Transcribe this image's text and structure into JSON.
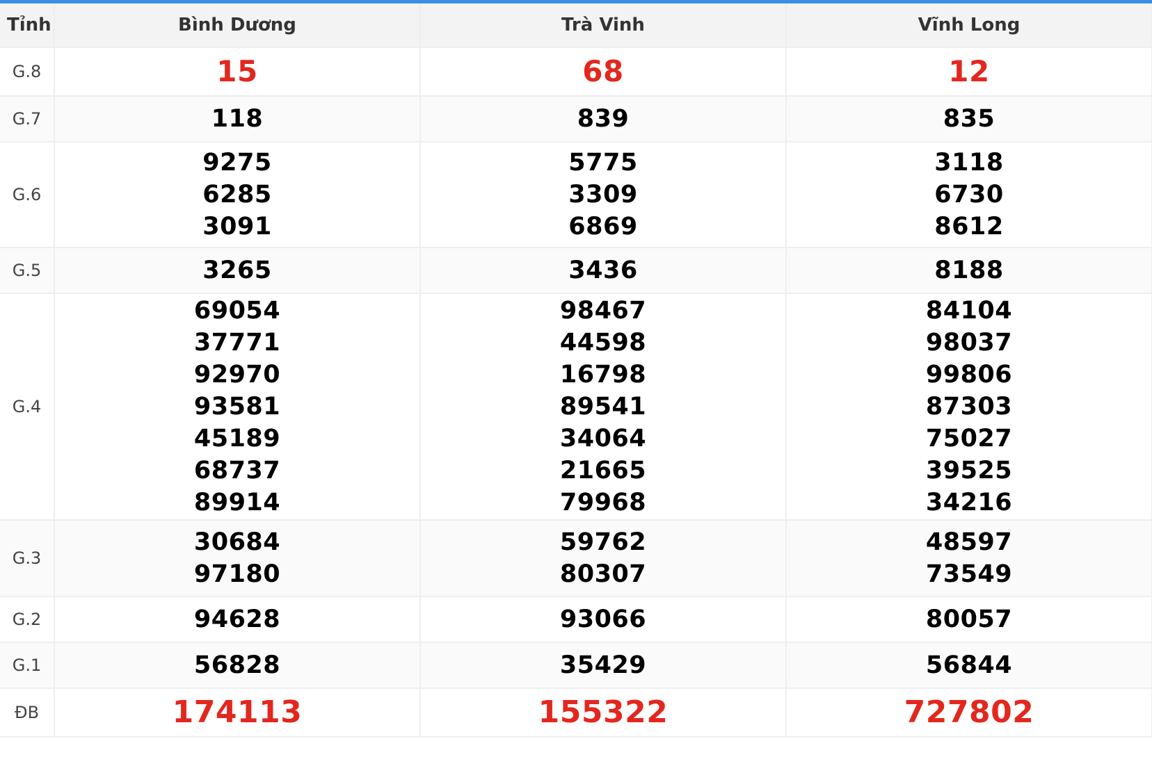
{
  "theme": {
    "accent": "#3a8ee6",
    "highlight": "#e3271e"
  },
  "header": {
    "label": "Tỉnh",
    "provinces": [
      "Bình Dương",
      "Trà Vinh",
      "Vĩnh Long"
    ]
  },
  "rows": [
    {
      "label": "G.8",
      "values": [
        [
          "15"
        ],
        [
          "68"
        ],
        [
          "12"
        ]
      ]
    },
    {
      "label": "G.7",
      "values": [
        [
          "118"
        ],
        [
          "839"
        ],
        [
          "835"
        ]
      ]
    },
    {
      "label": "G.6",
      "values": [
        [
          "9275",
          "6285",
          "3091"
        ],
        [
          "5775",
          "3309",
          "6869"
        ],
        [
          "3118",
          "6730",
          "8612"
        ]
      ]
    },
    {
      "label": "G.5",
      "values": [
        [
          "3265"
        ],
        [
          "3436"
        ],
        [
          "8188"
        ]
      ]
    },
    {
      "label": "G.4",
      "values": [
        [
          "69054",
          "37771",
          "92970",
          "93581",
          "45189",
          "68737",
          "89914"
        ],
        [
          "98467",
          "44598",
          "16798",
          "89541",
          "34064",
          "21665",
          "79968"
        ],
        [
          "84104",
          "98037",
          "99806",
          "87303",
          "75027",
          "39525",
          "34216"
        ]
      ]
    },
    {
      "label": "G.3",
      "values": [
        [
          "30684",
          "97180"
        ],
        [
          "59762",
          "80307"
        ],
        [
          "48597",
          "73549"
        ]
      ]
    },
    {
      "label": "G.2",
      "values": [
        [
          "94628"
        ],
        [
          "93066"
        ],
        [
          "80057"
        ]
      ]
    },
    {
      "label": "G.1",
      "values": [
        [
          "56828"
        ],
        [
          "35429"
        ],
        [
          "56844"
        ]
      ]
    },
    {
      "label": "ĐB",
      "values": [
        [
          "174113"
        ],
        [
          "155322"
        ],
        [
          "727802"
        ]
      ]
    }
  ]
}
